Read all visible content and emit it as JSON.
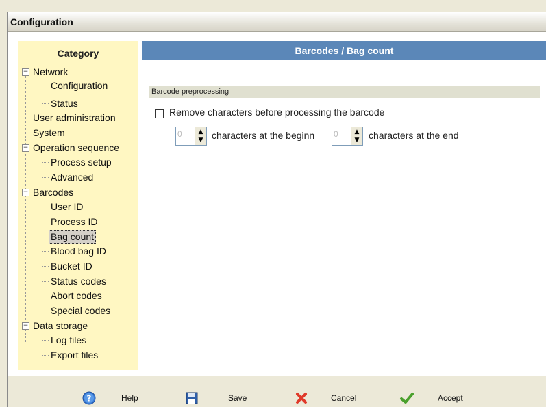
{
  "window": {
    "title": "Configuration"
  },
  "sidebar": {
    "title": "Category",
    "tree": [
      {
        "label": "Network",
        "expandable": true,
        "children": [
          "Configuration",
          "Status"
        ]
      },
      {
        "label": "User administration"
      },
      {
        "label": "System"
      },
      {
        "label": "Operation sequence",
        "expandable": true,
        "children": [
          "Process setup",
          "Advanced"
        ]
      },
      {
        "label": "Barcodes",
        "expandable": true,
        "children": [
          "User ID",
          "Process ID",
          "Bag count",
          "Blood bag ID",
          "Bucket ID",
          "Status codes",
          "Abort codes",
          "Special codes"
        ]
      },
      {
        "label": "Data storage",
        "expandable": true,
        "children": [
          "Log files",
          "Export files"
        ]
      }
    ],
    "selected": "Bag count"
  },
  "panel": {
    "title": "Barcodes / Bag count",
    "group_label": "Barcode preprocessing",
    "checkbox_label": "Remove characters before processing the barcode",
    "checkbox_checked": false,
    "begin_value": "0",
    "begin_label": "characters at the beginn",
    "end_value": "0",
    "end_label": "characters at the end"
  },
  "buttons": {
    "help": "Help",
    "save": "Save",
    "cancel": "Cancel",
    "accept": "Accept"
  },
  "icons": {
    "help": "help-circle-icon",
    "save": "floppy-disk-icon",
    "cancel": "red-x-icon",
    "accept": "green-check-icon"
  }
}
